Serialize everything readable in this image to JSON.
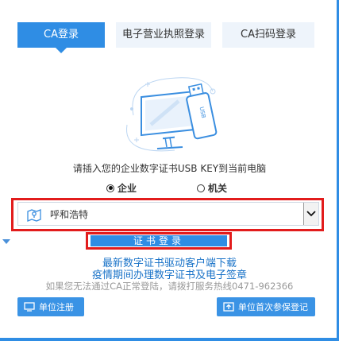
{
  "tabs": [
    {
      "label": "CA登录"
    },
    {
      "label": "电子营业执照登录"
    },
    {
      "label": "CA扫码登录"
    }
  ],
  "hint": "请插入您的企业数字证书USB KEY到当前电脑",
  "usb_label": "USB",
  "radios": [
    {
      "label": "企业",
      "selected": true
    },
    {
      "label": "机关",
      "selected": false
    }
  ],
  "city_select": {
    "value": "呼和浩特"
  },
  "login_button": "证书登录",
  "links": {
    "driver": "最新数字证书驱动客户端下载",
    "apply": "疫情期间办理数字证书及电子签章"
  },
  "note": "如果您无法通过CA正常登陆，请拨打服务热线0471-962366",
  "buttons": {
    "register": "单位注册",
    "first_register": "单位首次参保登记"
  },
  "colors": {
    "accent": "#2f8de4",
    "highlight": "#e21c1c",
    "link": "#1a73c8"
  }
}
